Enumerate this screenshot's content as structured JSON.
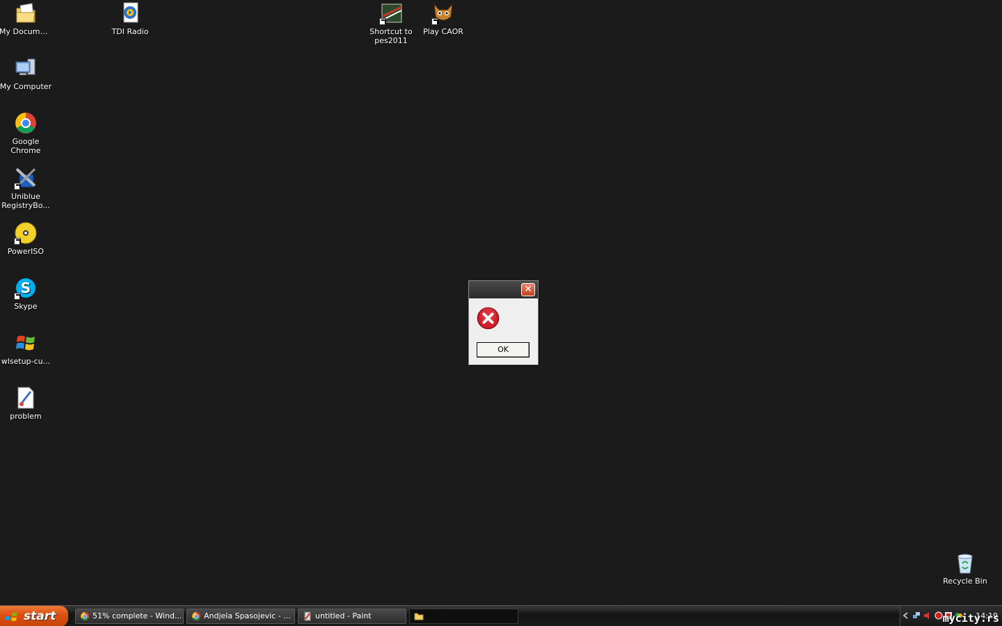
{
  "desktop": {
    "icons": [
      {
        "label": "My Documents",
        "icon": "my-documents-icon",
        "shortcut": false
      },
      {
        "label": "TDI Radio",
        "icon": "tdi-radio-icon",
        "shortcut": false
      },
      {
        "label": "Shortcut to pes2011",
        "icon": "pes2011-icon",
        "shortcut": true
      },
      {
        "label": "Play CAOR",
        "icon": "caor-icon",
        "shortcut": true
      },
      {
        "label": "My Computer",
        "icon": "my-computer-icon",
        "shortcut": false
      },
      {
        "label": "Google Chrome",
        "icon": "chrome-icon",
        "shortcut": false
      },
      {
        "label": "Uniblue RegistryBo...",
        "icon": "uniblue-icon",
        "shortcut": true
      },
      {
        "label": "PowerISO",
        "icon": "poweriso-icon",
        "shortcut": true
      },
      {
        "label": "Skype",
        "icon": "skype-icon",
        "shortcut": true
      },
      {
        "label": "wlsetup-cu...",
        "icon": "windows-live-icon",
        "shortcut": false
      },
      {
        "label": "problem",
        "icon": "paint-file-icon",
        "shortcut": false
      },
      {
        "label": "Recycle Bin",
        "icon": "recycle-bin-icon",
        "shortcut": false
      }
    ]
  },
  "dialog": {
    "close_glyph": "✕",
    "icon": "error-icon",
    "ok_label": "OK"
  },
  "taskbar": {
    "start_label": "start",
    "tasks": [
      {
        "label": "51% complete - Wind...",
        "icon": "chrome-icon",
        "active": false
      },
      {
        "label": "Andjela Spasojevic - ...",
        "icon": "chrome-icon",
        "active": false
      },
      {
        "label": "untitled - Paint",
        "icon": "paint-icon",
        "active": false
      },
      {
        "label": "",
        "icon": "folder-icon",
        "active": true
      }
    ],
    "clock": "14:19"
  },
  "watermark": "mycity.rs",
  "colors": {
    "desktop_bg": "#1b1b1b",
    "start_orange": "#d94f10",
    "error_red": "#d0202a"
  }
}
